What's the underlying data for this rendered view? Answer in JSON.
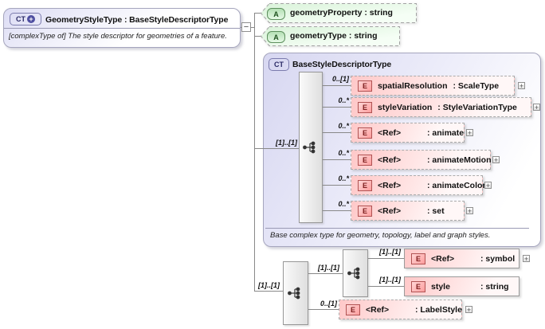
{
  "colors": {
    "container_lavender": "#d7d7f1",
    "element_pink": "#ffc8c8",
    "attribute_green": "#d9f3d9",
    "element_badge_red": "#b05353",
    "connector_gray": "#888888"
  },
  "root": {
    "badge": "CT",
    "badge_plus": "+",
    "title": "GeometryStyleType : BaseStyleDescriptorType",
    "annotation": "[complexType of] The style descriptor for geometries of a feature.",
    "collapse_glyph": "−"
  },
  "attributes": [
    {
      "badge": "A",
      "label": "geometryProperty : string"
    },
    {
      "badge": "A",
      "label": "geometryType : string"
    }
  ],
  "base": {
    "badge": "CT",
    "title": "BaseStyleDescriptorType",
    "annotation": "Base complex type for geometry, topology, label and graph styles.",
    "cardinality": "[1]..[1]",
    "elements": [
      {
        "cardinality": "0..[1]",
        "badge": "E",
        "name": "spatialResolution",
        "type": ": ScaleType",
        "expand": "+"
      },
      {
        "cardinality": "0..*",
        "badge": "E",
        "name": "styleVariation",
        "type": ": StyleVariationType",
        "expand": "+"
      },
      {
        "cardinality": "0..*",
        "badge": "E",
        "name": "<Ref>",
        "type": ": animate",
        "expand": "+"
      },
      {
        "cardinality": "0..*",
        "badge": "E",
        "name": "<Ref>",
        "type": ": animateMotion",
        "expand": "+"
      },
      {
        "cardinality": "0..*",
        "badge": "E",
        "name": "<Ref>",
        "type": ": animateColor",
        "expand": "+"
      },
      {
        "cardinality": "0..*",
        "badge": "E",
        "name": "<Ref>",
        "type": ": set",
        "expand": "+"
      }
    ]
  },
  "content": {
    "outer_cardinality": "[1]..[1]",
    "inner_cardinality": "[1]..[1]",
    "elements": [
      {
        "cardinality": "[1]..[1]",
        "badge": "E",
        "name": "<Ref>",
        "type": ": symbol",
        "expand": "+"
      },
      {
        "cardinality": "[1]..[1]",
        "badge": "E",
        "name": "style",
        "type": ": string"
      },
      {
        "cardinality": "0..[1]",
        "badge": "E",
        "name": "<Ref>",
        "type": ": LabelStyle",
        "expand": "+"
      }
    ]
  }
}
